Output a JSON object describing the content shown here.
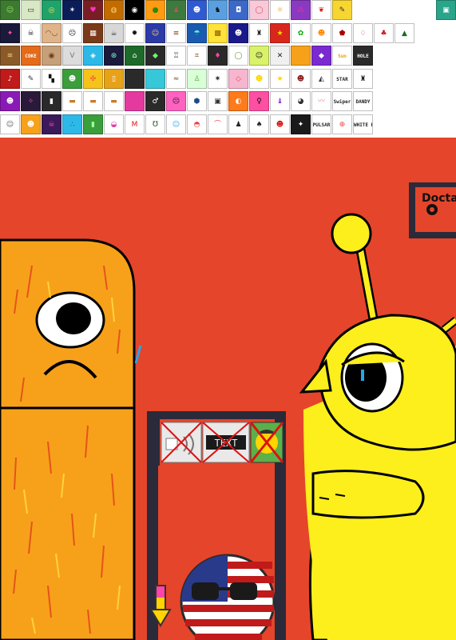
{
  "app": {
    "background_color": "#e5452a"
  },
  "grid": {
    "rows": [
      [
        {
          "bg": "#3b7a2f",
          "fg": "#9be06b",
          "glyph": "☺",
          "icon": "green-face-icon"
        },
        {
          "bg": "#d9e8c4",
          "fg": "#222",
          "glyph": "▭",
          "icon": "card-icon"
        },
        {
          "bg": "#1fa36b",
          "fg": "#ffe14a",
          "glyph": "◎",
          "icon": "spiral-icon"
        },
        {
          "bg": "#0b1d59",
          "fg": "#fff",
          "glyph": "✶",
          "icon": "star-burst-icon"
        },
        {
          "bg": "#7a1e26",
          "fg": "#f3c",
          "glyph": "♥",
          "icon": "heart-icon"
        },
        {
          "bg": "#c26c00",
          "fg": "#ffd36b",
          "glyph": "◍",
          "icon": "dots-icon"
        },
        {
          "bg": "#000000",
          "fg": "#fff",
          "glyph": "◉",
          "icon": "eye-icon"
        },
        {
          "bg": "#ff9b12",
          "fg": "#2a8a00",
          "glyph": "●",
          "icon": "orange-icon"
        },
        {
          "bg": "#3d7a3d",
          "fg": "#b55",
          "glyph": "♟",
          "icon": "figure-icon"
        },
        {
          "bg": "#2f5ad1",
          "fg": "#fff",
          "glyph": "☻",
          "icon": "blue-face-icon"
        },
        {
          "bg": "#5aa0e0",
          "fg": "#111",
          "glyph": "♞",
          "icon": "cat-icon"
        },
        {
          "bg": "#3c68c9",
          "fg": "#fff",
          "glyph": "◘",
          "icon": "controller-icon"
        },
        {
          "bg": "#f7c9d9",
          "fg": "#e45",
          "glyph": "◯",
          "icon": "donut-icon"
        },
        {
          "bg": "#ffffff",
          "fg": "#e8a000",
          "glyph": "☼",
          "icon": "sun-icon"
        },
        {
          "bg": "#8a3ac0",
          "fg": "#d3a",
          "glyph": "⁂",
          "icon": "grapes-icon"
        },
        {
          "bg": "#ffffff",
          "fg": "#d11",
          "glyph": "❦",
          "icon": "chili-icon"
        },
        {
          "bg": "#f7d631",
          "fg": "#333",
          "glyph": "✎",
          "icon": "note-icon"
        },
        {
          "bg": "#ffffff",
          "fg": "#ffffff",
          "glyph": "",
          "icon": "blank-tile"
        },
        {
          "bg": "#ffffff",
          "fg": "#ffffff",
          "glyph": "",
          "icon": "blank-tile"
        },
        {
          "bg": "#ffffff",
          "fg": "#ffffff",
          "glyph": "",
          "icon": "blank-tile"
        },
        {
          "bg": "#ffffff",
          "fg": "#ffffff",
          "glyph": "",
          "icon": "blank-tile"
        },
        {
          "bg": "#2aa48a",
          "fg": "#fff",
          "glyph": "▣",
          "icon": "teal-box-icon"
        }
      ],
      [
        {
          "bg": "#1a1a3a",
          "fg": "#ff4fa3",
          "glyph": "✦",
          "icon": "sparkle-icon"
        },
        {
          "bg": "#ffffff",
          "fg": "#111",
          "glyph": "☠",
          "icon": "creature-icon"
        },
        {
          "bg": "#e0b48a",
          "fg": "#6b3a14",
          "glyph": "◠◡",
          "icon": "eyes-icon"
        },
        {
          "bg": "#ffffff",
          "fg": "#111",
          "glyph": "☹",
          "icon": "frown-icon"
        },
        {
          "bg": "#7a3a1a",
          "fg": "#fff",
          "glyph": "▦",
          "icon": "window-icon"
        },
        {
          "bg": "#d8d8d8",
          "fg": "#333",
          "glyph": "☕",
          "icon": "cup-icon"
        },
        {
          "bg": "#ffffff",
          "fg": "#111",
          "glyph": "✹",
          "icon": "cow-spots-icon"
        },
        {
          "bg": "#2c3aa8",
          "fg": "#ffd15a",
          "glyph": "☺",
          "icon": "character-icon"
        },
        {
          "bg": "#ffffff",
          "fg": "#7a4010",
          "glyph": "≡",
          "icon": "burger-icon"
        },
        {
          "bg": "#1a5ab0",
          "fg": "#5fd",
          "glyph": "☂",
          "icon": "umbrella-icon"
        },
        {
          "bg": "#ffe23a",
          "fg": "#8a5a00",
          "glyph": "▩",
          "icon": "sponge-icon"
        },
        {
          "bg": "#1a1a8a",
          "fg": "#fff",
          "glyph": "☻",
          "icon": "night-face-icon"
        },
        {
          "bg": "#ffffff",
          "fg": "#222",
          "glyph": "♜",
          "icon": "tower-icon"
        },
        {
          "bg": "#d8261c",
          "fg": "#ffd400",
          "glyph": "★",
          "icon": "flag-star-icon"
        },
        {
          "bg": "#ffffff",
          "fg": "#0a0",
          "glyph": "✿",
          "icon": "flower-icon"
        },
        {
          "bg": "#ffffff",
          "fg": "#f80",
          "glyph": "☻",
          "icon": "mouse-icon"
        },
        {
          "bg": "#ffffff",
          "fg": "#a00",
          "glyph": "⬟",
          "icon": "red-blob-icon"
        },
        {
          "bg": "#ffffff",
          "fg": "#c22",
          "glyph": "♢",
          "icon": "drop-icon"
        },
        {
          "bg": "#ffffff",
          "fg": "#c11",
          "glyph": "♣",
          "icon": "red-figure-icon"
        },
        {
          "bg": "#ffffff",
          "fg": "#1a6a2a",
          "glyph": "▲",
          "icon": "tree-icon"
        },
        {
          "bg": "#ffffff",
          "fg": "#ffffff",
          "glyph": "",
          "icon": "blank-tile"
        },
        {
          "bg": "#ffffff",
          "fg": "#ffffff",
          "glyph": "",
          "icon": "blank-tile"
        }
      ],
      [
        {
          "bg": "#8a5a28",
          "fg": "#f5d08a",
          "glyph": "≋",
          "icon": "bread-icon"
        },
        {
          "bg": "#e36b1a",
          "fg": "#fff",
          "glyph": "COKE",
          "small": true,
          "icon": "coke-label-icon"
        },
        {
          "bg": "#c6a07a",
          "fg": "#6b3a14",
          "glyph": "◉",
          "icon": "pie-icon"
        },
        {
          "bg": "#dcdcdc",
          "fg": "#777",
          "glyph": "V",
          "icon": "v-letter-icon"
        },
        {
          "bg": "#2db9e8",
          "fg": "#fff",
          "glyph": "◈",
          "icon": "water-drop-icon"
        },
        {
          "bg": "#1a1a3a",
          "fg": "#7fd",
          "glyph": "⊛",
          "icon": "galaxy-icon"
        },
        {
          "bg": "#1e6a2a",
          "fg": "#fff",
          "glyph": "⌂",
          "icon": "fence-icon"
        },
        {
          "bg": "#2a2a2a",
          "fg": "#6f6",
          "glyph": "◆",
          "icon": "gem-icon"
        },
        {
          "bg": "#ffffff",
          "fg": "#333",
          "glyph": "♖",
          "icon": "fort-icon"
        },
        {
          "bg": "#ffffff",
          "fg": "#6a3a00",
          "glyph": "⌗",
          "icon": "bark-icon"
        },
        {
          "bg": "#2a2a2a",
          "fg": "#f4a",
          "glyph": "♦",
          "icon": "pink-gem-icon"
        },
        {
          "bg": "#ffffff",
          "fg": "#5b9b2a",
          "glyph": "◯",
          "icon": "green-ring-icon"
        },
        {
          "bg": "#d9f26a",
          "fg": "#111",
          "glyph": "☺",
          "icon": "lime-face-icon"
        },
        {
          "bg": "#f0f0f0",
          "fg": "#222",
          "glyph": "✕",
          "icon": "cross-icon"
        },
        {
          "bg": "#f7a11a",
          "fg": "#fff",
          "glyph": "",
          "icon": "orange-tile"
        },
        {
          "bg": "#7a2ad0",
          "fg": "#fff",
          "glyph": "◆",
          "icon": "purple-diamond-icon"
        },
        {
          "bg": "#ffffff",
          "fg": "#e8a000",
          "glyph": "Sun",
          "small": true,
          "icon": "sun-label-icon"
        },
        {
          "bg": "#2a2a2a",
          "fg": "#fff",
          "glyph": "HOLE",
          "small": true,
          "icon": "black-hole-icon"
        },
        {
          "bg": "#ffffff",
          "fg": "#ffffff",
          "glyph": "",
          "icon": "blank-tile"
        },
        {
          "bg": "#ffffff",
          "fg": "#ffffff",
          "glyph": "",
          "icon": "blank-tile"
        },
        {
          "bg": "#ffffff",
          "fg": "#ffffff",
          "glyph": "",
          "icon": "blank-tile"
        },
        {
          "bg": "#ffffff",
          "fg": "#ffffff",
          "glyph": "",
          "icon": "blank-tile"
        }
      ],
      [
        {
          "bg": "#c01a1a",
          "fg": "#fff",
          "glyph": "♪",
          "icon": "stick-figure-icon"
        },
        {
          "bg": "#ffffff",
          "fg": "#333",
          "glyph": "✎",
          "icon": "doodle-icon"
        },
        {
          "bg": "#ffffff",
          "fg": "#111",
          "glyph": "▚",
          "icon": "checker-icon"
        },
        {
          "bg": "#3a9e3a",
          "fg": "#fff",
          "glyph": "☻",
          "icon": "green-creature-icon"
        },
        {
          "bg": "#f7c21a",
          "fg": "#e44",
          "glyph": "✣",
          "icon": "spinner-icon"
        },
        {
          "bg": "#e8a21a",
          "fg": "#fff",
          "glyph": "▯",
          "icon": "fridge-icon"
        },
        {
          "bg": "#2a2a2a",
          "fg": "#fff",
          "glyph": "",
          "icon": "dark-tile"
        },
        {
          "bg": "#36c7d9",
          "fg": "#fff",
          "glyph": "",
          "icon": "cyan-tile"
        },
        {
          "bg": "#ffffff",
          "fg": "#7a4a2a",
          "glyph": "≈",
          "icon": "hair-icon"
        },
        {
          "bg": "#d8ffd8",
          "fg": "#6a3",
          "glyph": "♙",
          "icon": "tiny-figure-icon"
        },
        {
          "bg": "#ffffff",
          "fg": "#333",
          "glyph": "✷",
          "icon": "spiky-sun-icon"
        },
        {
          "bg": "#f7b6d0",
          "fg": "#e44",
          "glyph": "◇",
          "icon": "pink-diamond-icon"
        },
        {
          "bg": "#ffffff",
          "fg": "#ffd400",
          "glyph": "☻",
          "icon": "yellow-blob-icon"
        },
        {
          "bg": "#ffffff",
          "fg": "#ffd400",
          "glyph": "★",
          "icon": "star-icon"
        },
        {
          "bg": "#ffffff",
          "fg": "#8a1a1a",
          "glyph": "☻",
          "icon": "brown-face-icon"
        },
        {
          "bg": "#ffffff",
          "fg": "#333",
          "glyph": "◭",
          "icon": "onigiri-icon"
        },
        {
          "bg": "#ffffff",
          "fg": "#222",
          "glyph": "STAR",
          "small": true,
          "icon": "star-label-icon"
        },
        {
          "bg": "#ffffff",
          "fg": "#222",
          "glyph": "♜",
          "icon": "statue-icon"
        },
        {
          "bg": "#ffffff",
          "fg": "#ffffff",
          "glyph": "",
          "icon": "blank-tile"
        },
        {
          "bg": "#ffffff",
          "fg": "#ffffff",
          "glyph": "",
          "icon": "blank-tile"
        },
        {
          "bg": "#ffffff",
          "fg": "#ffffff",
          "glyph": "",
          "icon": "blank-tile"
        },
        {
          "bg": "#ffffff",
          "fg": "#ffffff",
          "glyph": "",
          "icon": "blank-tile"
        }
      ],
      [
        {
          "bg": "#8a1ab5",
          "fg": "#fff",
          "glyph": "☻",
          "icon": "purple-creature-icon"
        },
        {
          "bg": "#2a1a3a",
          "fg": "#f4a",
          "glyph": "✧",
          "icon": "ribbon-icon"
        },
        {
          "bg": "#2a2a2a",
          "fg": "#fff",
          "glyph": "▮",
          "icon": "book-icon"
        },
        {
          "bg": "#ffffff",
          "fg": "#c97a2a",
          "glyph": "▬",
          "icon": "baguette-icon"
        },
        {
          "bg": "#ffffff",
          "fg": "#c97a2a",
          "glyph": "▬",
          "icon": "loaf-icon"
        },
        {
          "bg": "#ffffff",
          "fg": "#c97a2a",
          "glyph": "▬",
          "icon": "bread-slice-icon"
        },
        {
          "bg": "#e43aa0",
          "fg": "#fff",
          "glyph": "",
          "icon": "magenta-tile"
        },
        {
          "bg": "#2a2a2a",
          "fg": "#fff",
          "glyph": "♂",
          "icon": "arrow-figure-icon"
        },
        {
          "bg": "#ff62c0",
          "fg": "#111",
          "glyph": "☹",
          "icon": "pink-face-icon"
        },
        {
          "bg": "#ffffff",
          "fg": "#1a4a8a",
          "glyph": "⬢",
          "icon": "hat-icon"
        },
        {
          "bg": "#ffffff",
          "fg": "#333",
          "glyph": "▣",
          "icon": "computer-icon"
        },
        {
          "bg": "#ff7a1a",
          "fg": "#fff",
          "glyph": "◐",
          "icon": "phone-icon"
        },
        {
          "bg": "#ff4fa3",
          "fg": "#111",
          "glyph": "♀",
          "icon": "pink-figure-icon"
        },
        {
          "bg": "#ffffff",
          "fg": "#8a2ad0",
          "glyph": "♝",
          "icon": "purple-figure-icon"
        },
        {
          "bg": "#ffffff",
          "fg": "#333",
          "glyph": "◕",
          "icon": "bird-icon"
        },
        {
          "bg": "#ffffff",
          "fg": "#e88",
          "glyph": "〰",
          "icon": "worm-icon"
        },
        {
          "bg": "#ffffff",
          "fg": "#222",
          "glyph": "Swiper",
          "small": true,
          "icon": "swiper-label-icon"
        },
        {
          "bg": "#ffffff",
          "fg": "#222",
          "glyph": "DANDY",
          "small": true,
          "icon": "dandy-label-icon"
        },
        {
          "bg": "#ffffff",
          "fg": "#ffffff",
          "glyph": "",
          "icon": "blank-tile"
        },
        {
          "bg": "#ffffff",
          "fg": "#ffffff",
          "glyph": "",
          "icon": "blank-tile"
        },
        {
          "bg": "#ffffff",
          "fg": "#ffffff",
          "glyph": "",
          "icon": "blank-tile"
        },
        {
          "bg": "#ffffff",
          "fg": "#ffffff",
          "glyph": "",
          "icon": "blank-tile"
        }
      ],
      [
        {
          "bg": "#ffffff",
          "fg": "#555",
          "glyph": "☺",
          "icon": "ghost-icon"
        },
        {
          "bg": "#f7a11a",
          "fg": "#fff",
          "glyph": "☻",
          "icon": "dog-icon"
        },
        {
          "bg": "#3a1a5a",
          "fg": "#f4a",
          "glyph": "☠",
          "icon": "angry-face-icon"
        },
        {
          "bg": "#2db9e8",
          "fg": "#1a4a8a",
          "glyph": "∴",
          "icon": "dots-blue-icon"
        },
        {
          "bg": "#3a9e3a",
          "fg": "#9f9",
          "glyph": "▮",
          "icon": "pencil-icon"
        },
        {
          "bg": "#ffffff",
          "fg": "#e43aa0",
          "glyph": "◒",
          "icon": "cupcake-icon"
        },
        {
          "bg": "#ffffff",
          "fg": "#d11",
          "glyph": "M",
          "icon": "fries-icon"
        },
        {
          "bg": "#ffffff",
          "fg": "#1a3a1a",
          "glyph": "Ʊ",
          "icon": "magnet-icon"
        },
        {
          "bg": "#ffffff",
          "fg": "#2aa4e8",
          "glyph": "☺",
          "icon": "smile-face-icon"
        },
        {
          "bg": "#ffffff",
          "fg": "#e44",
          "glyph": "◓",
          "icon": "green-cupcake-icon"
        },
        {
          "bg": "#ffffff",
          "fg": "#e44",
          "glyph": "⌒",
          "icon": "rainbow-icon"
        },
        {
          "bg": "#ffffff",
          "fg": "#222",
          "glyph": "♟",
          "icon": "suit-icon"
        },
        {
          "bg": "#ffffff",
          "fg": "#2a2a2a",
          "glyph": "♠",
          "icon": "dark-figure-icon"
        },
        {
          "bg": "#ffffff",
          "fg": "#d11",
          "glyph": "☻",
          "icon": "red-face-icon"
        },
        {
          "bg": "#1a1a1a",
          "fg": "#fff",
          "glyph": "✦",
          "icon": "black-star-icon"
        },
        {
          "bg": "#ffffff",
          "fg": "#222",
          "glyph": "PULSAR",
          "small": true,
          "icon": "pulsar-label-icon"
        },
        {
          "bg": "#ffffff",
          "fg": "#e44",
          "glyph": "⊕",
          "icon": "flower-face-icon"
        },
        {
          "bg": "#ffffff",
          "fg": "#222",
          "glyph": "WHITE HOLE",
          "small": true,
          "icon": "white-hole-icon"
        },
        {
          "bg": "#ffffff",
          "fg": "#ffffff",
          "glyph": "",
          "icon": "blank-tile"
        },
        {
          "bg": "#ffffff",
          "fg": "#ffffff",
          "glyph": "",
          "icon": "blank-tile"
        },
        {
          "bg": "#ffffff",
          "fg": "#ffffff",
          "glyph": "",
          "icon": "blank-tile"
        },
        {
          "bg": "#ffffff",
          "fg": "#ffffff",
          "glyph": "",
          "icon": "blank-tile"
        }
      ]
    ]
  },
  "gate": {
    "text_label": "TEXT",
    "slot_icons": [
      "sound-icon",
      "text-icon",
      "image-icon"
    ],
    "disabled": true
  },
  "sign": {
    "label": "Docta"
  },
  "colors": {
    "orange_character": "#f7a11a",
    "yellow_character": "#fcef1c",
    "frame": "#2a2a3a"
  }
}
